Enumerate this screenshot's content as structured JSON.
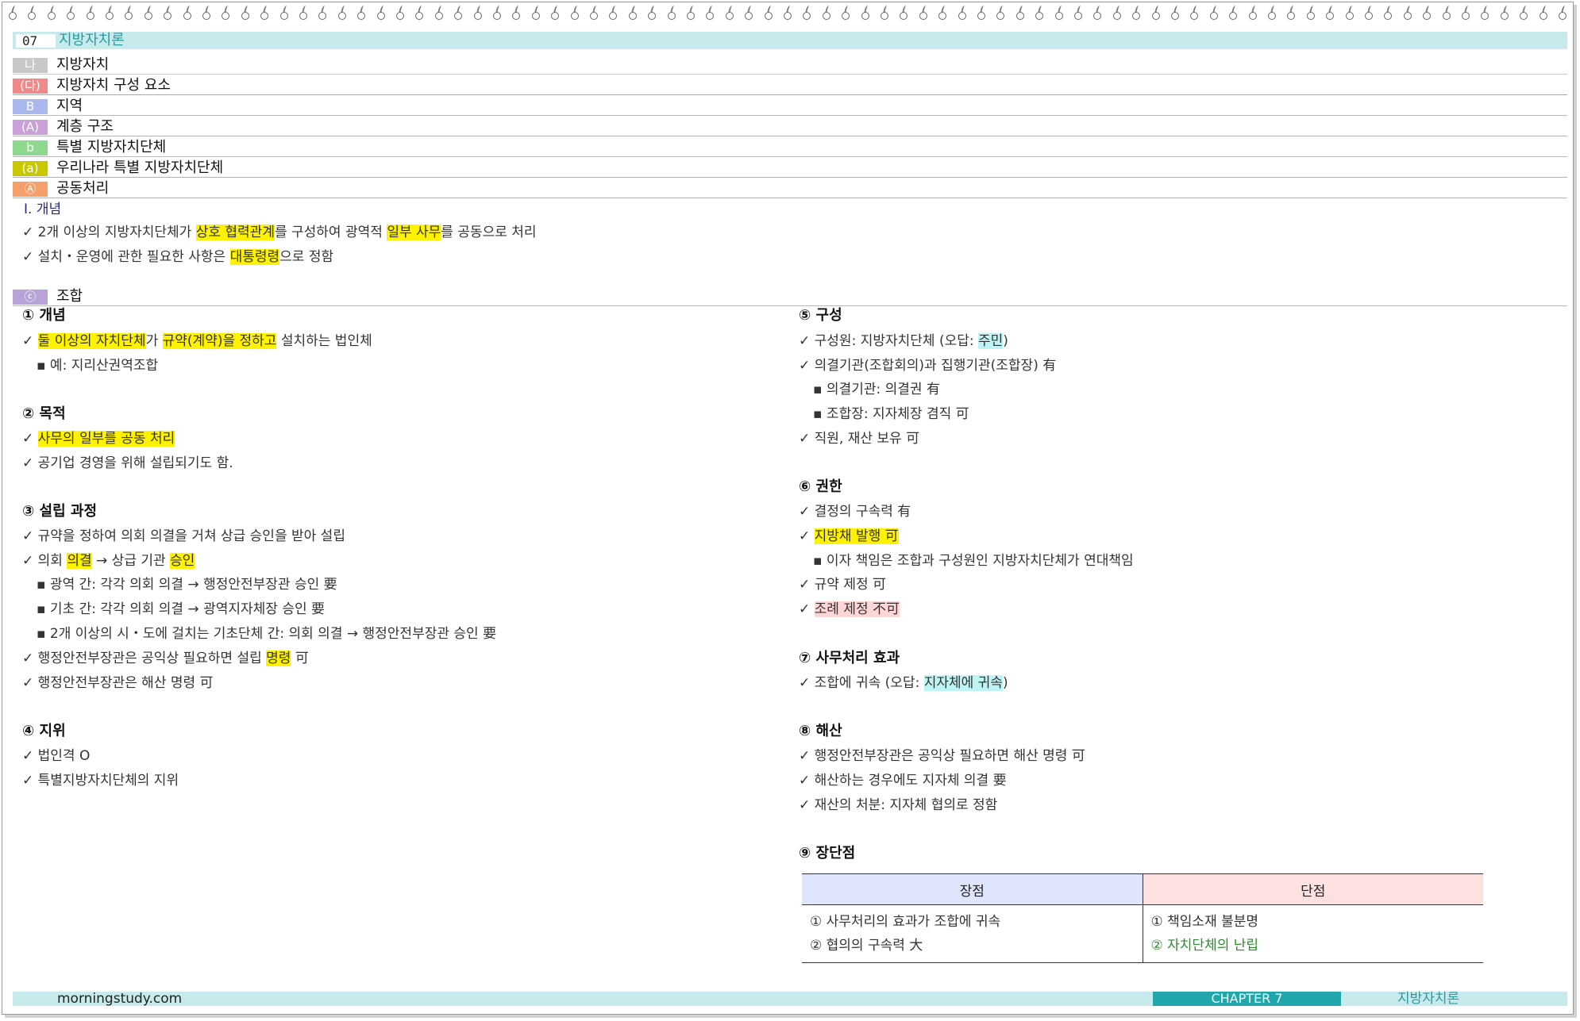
{
  "header": {
    "chapter_number": "07",
    "chapter_title": "지방자치론"
  },
  "outline": [
    {
      "badge": "나",
      "label": "지방자치",
      "color": "#c8c8c8"
    },
    {
      "badge": "(다)",
      "label": "지방자치 구성 요소",
      "color": "#f08a8a"
    },
    {
      "badge": "B",
      "label": "지역",
      "color": "#a9b9f0"
    },
    {
      "badge": "(A)",
      "label": "계층 구조",
      "color": "#c9a0d8"
    },
    {
      "badge": "b",
      "label": "특별 지방자치단체",
      "color": "#8fd88f"
    },
    {
      "badge": "(a)",
      "label": "우리나라 특별 지방자치단체",
      "color": "#c8c800"
    },
    {
      "badge": "Ⓐ",
      "label": "공동처리",
      "color": "#f5a06a"
    }
  ],
  "concept": {
    "title": "Ⅰ. 개념",
    "line1": {
      "pre": "✓ 2개 이상의 지방자치단체가 ",
      "hl1": "상호 협력관계",
      "mid": "를 구성하여 광역적 ",
      "hl2": "일부 사무",
      "post": "를 공동으로 처리"
    },
    "line2": {
      "pre": "✓ 설치・운영에 관한 필요한 사항은 ",
      "hl": "대통령령",
      "post": "으로 정함"
    }
  },
  "section_c": {
    "badge": "ⓒ",
    "label": "조합",
    "color": "#b7a3d8"
  },
  "left": {
    "s1": {
      "title": "① 개념",
      "l1": {
        "pre": "✓ ",
        "hl1": "둘 이상의 자치단체",
        "mid": "가 ",
        "hl2": "규약(계약)을 정하고",
        "post": " 설치하는 법인체"
      },
      "l2": "▪ 예: 지리산권역조합"
    },
    "s2": {
      "title": "② 목적",
      "l1": {
        "pre": "✓ ",
        "hl": "사무의 일부를 공동 처리"
      },
      "l2": "✓ 공기업 경영을 위해 설립되기도 함."
    },
    "s3": {
      "title": "③ 설립 과정",
      "l1": "✓ 규약을 정하여 의회 의결을 거쳐 상급 승인을 받아 설립",
      "l2": {
        "pre": "✓ 의회 ",
        "hl1": "의결",
        "mid": " → 상급 기관 ",
        "hl2": "승인"
      },
      "l3": "▪ 광역 간: 각각 의회 의결 → 행정안전부장관 승인 要",
      "l4": "▪ 기초 간: 각각 의회 의결 → 광역지자체장 승인 要",
      "l5": "▪ 2개 이상의 시・도에 걸치는 기초단체 간: 의회 의결 → 행정안전부장관 승인 要",
      "l6": {
        "pre": "✓ 행정안전부장관은 공익상 필요하면 설립 ",
        "hl": "명령",
        "post": " 可"
      },
      "l7": "✓ 행정안전부장관은 해산 명령 可"
    },
    "s4": {
      "title": "④ 지위",
      "l1": "✓ 법인격 O",
      "l2": "✓ 특별지방자치단체의 지위"
    }
  },
  "right": {
    "s5": {
      "title": "⑤ 구성",
      "l1": {
        "pre": "✓ 구성원: 지방자치단체 (오답: ",
        "hl": "주민",
        "post": ")"
      },
      "l2": "✓ 의결기관(조합회의)과 집행기관(조합장) 有",
      "l3": "▪ 의결기관: 의결권 有",
      "l4": "▪ 조합장: 지자체장 겸직 可",
      "l5": "✓ 직원, 재산 보유 可"
    },
    "s6": {
      "title": "⑥ 권한",
      "l1": "✓ 결정의 구속력 有",
      "l2": {
        "pre": "✓ ",
        "hl": "지방채 발행 可"
      },
      "l3": "▪ 이자 책임은 조합과 구성원인 지방자치단체가 연대책임",
      "l4": "✓ 규약 제정 可",
      "l5": {
        "pre": "✓ ",
        "hl": "조례 제정 不可"
      }
    },
    "s7": {
      "title": "⑦ 사무처리 효과",
      "l1": {
        "pre": "✓ 조합에 귀속 (오답: ",
        "hl": "지자체에 귀속",
        "post": ")"
      }
    },
    "s8": {
      "title": "⑧ 해산",
      "l1": "✓ 행정안전부장관은 공익상 필요하면 해산 명령 可",
      "l2": "✓ 해산하는 경우에도 지자체 의결 要",
      "l3": "✓ 재산의 처분: 지자체 협의로 정함"
    },
    "s9": {
      "title": "⑨ 장단점",
      "table": {
        "col_pros": "장점",
        "col_cons": "단점",
        "pros": [
          "① 사무처리의 효과가 조합에 귀속",
          "② 협의의 구속력 大"
        ],
        "cons": [
          "① 책임소재 불분명",
          "② 자치단체의 난립"
        ]
      }
    }
  },
  "footer": {
    "site": "morningstudy.com",
    "chapter": "CHAPTER 7",
    "subject": "지방자치론"
  }
}
